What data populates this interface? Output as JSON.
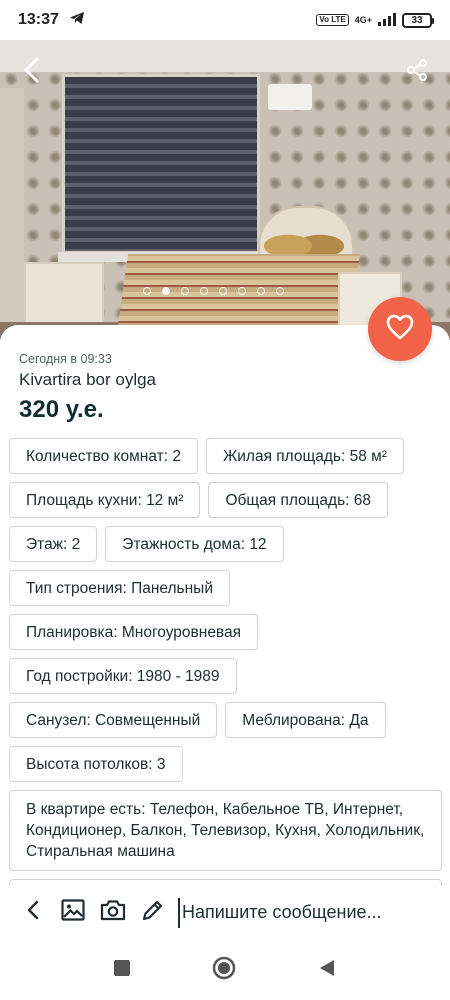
{
  "status_bar": {
    "time": "13:37",
    "volte": "Vo LTE",
    "network": "4G+",
    "battery": "33"
  },
  "photo": {
    "slide_count": 8,
    "active_slide": 1
  },
  "listing": {
    "date": "Сегодня в 09:33",
    "title": "Kivartira bor oylga",
    "price": "320 у.е."
  },
  "params": [
    "Количество комнат: 2",
    "Жилая площадь: 58 м²",
    "Площадь кухни: 12 м²",
    "Общая площадь: 68",
    "Этаж: 2",
    "Этажность дома: 12",
    "Тип строения: Панельный",
    "Планировка: Многоуровневая",
    "Год постройки: 1980 - 1989",
    "Санузел: Совмещенный",
    "Меблирована: Да",
    "Высота потолков: 3",
    "В квартире есть: Телефон, Кабельное ТВ, Интернет, Кондиционер, Балкон, Телевизор, Кухня, Холодильник, Стиральная машина"
  ],
  "composer": {
    "placeholder": "Напишите сообщение..."
  },
  "colors": {
    "accent": "#f2644a",
    "text_dark": "#0e2c32",
    "chip_border": "#cfd5d6"
  },
  "icons": {
    "back": "chevron-left-icon",
    "share": "share-icon",
    "favorite": "heart-icon",
    "gallery": "image-icon",
    "camera": "camera-icon",
    "edit": "pencil-icon"
  }
}
